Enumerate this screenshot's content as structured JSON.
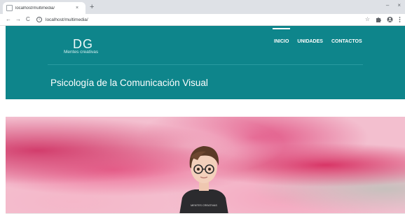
{
  "browser": {
    "tab_title": "localhost/multimedia/",
    "tab_close": "×",
    "new_tab": "+",
    "url": "localhost/multimedia/",
    "back": "←",
    "forward": "→",
    "reload": "C",
    "info": "i",
    "star": "☆",
    "window_minimize": "–",
    "window_close": "×"
  },
  "site": {
    "logo": "DG",
    "logo_subtitle": "Mentes creativas",
    "nav": [
      {
        "label": "INICIO",
        "active": true
      },
      {
        "label": "UNIDADES",
        "active": false
      },
      {
        "label": "CONTACTOS",
        "active": false
      }
    ],
    "page_title": "Psicología de la Comunicación Visual"
  },
  "hero": {
    "shirt_text": "MENTES CREATIVAS"
  },
  "colors": {
    "header_teal": "#0e858b",
    "hero_pink": "#e04d80"
  }
}
